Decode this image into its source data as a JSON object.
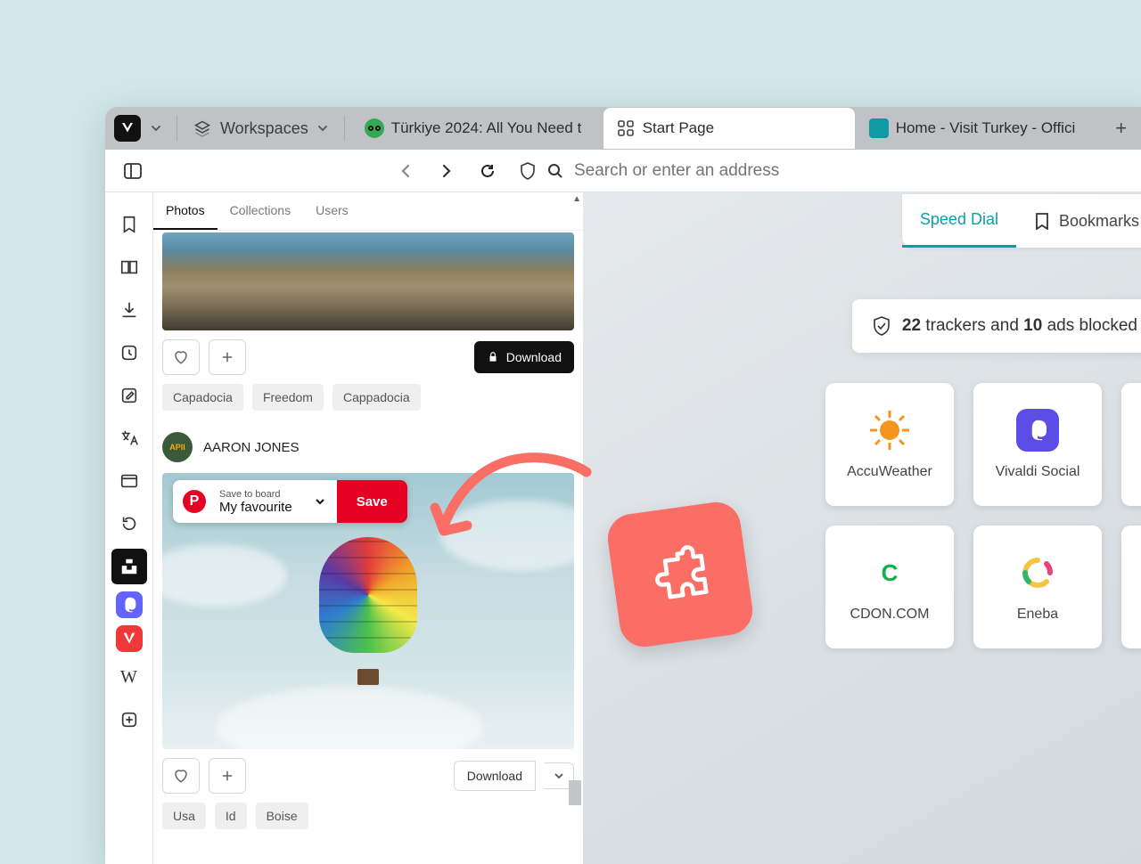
{
  "workspaces_label": "Workspaces",
  "tabs": [
    {
      "label": "Türkiye 2024: All You Need t"
    },
    {
      "label": "Start Page"
    },
    {
      "label": "Home - Visit Turkey - Offici"
    }
  ],
  "address_placeholder": "Search or enter an address",
  "panel": {
    "tabs": {
      "photos": "Photos",
      "collections": "Collections",
      "users": "Users"
    },
    "download": "Download",
    "tags1": [
      "Capadocia",
      "Freedom",
      "Cappadocia"
    ],
    "author": "AARON JONES",
    "save_label": "Save to board",
    "save_board": "My favourite",
    "save_btn": "Save",
    "download2": "Download",
    "tags2": [
      "Usa",
      "Id",
      "Boise"
    ]
  },
  "side_items": {
    "wikipedia": "W"
  },
  "speed": {
    "tab1": "Speed Dial",
    "tab2": "Bookmarks"
  },
  "tracker": {
    "n1": "22",
    "t1": " trackers and ",
    "n2": "10",
    "t2": " ads blocked"
  },
  "tiles": {
    "accuweather": "AccuWeather",
    "vivaldi": "Vivaldi Social",
    "cdon": "CDON.COM",
    "eneba": "Eneba"
  }
}
